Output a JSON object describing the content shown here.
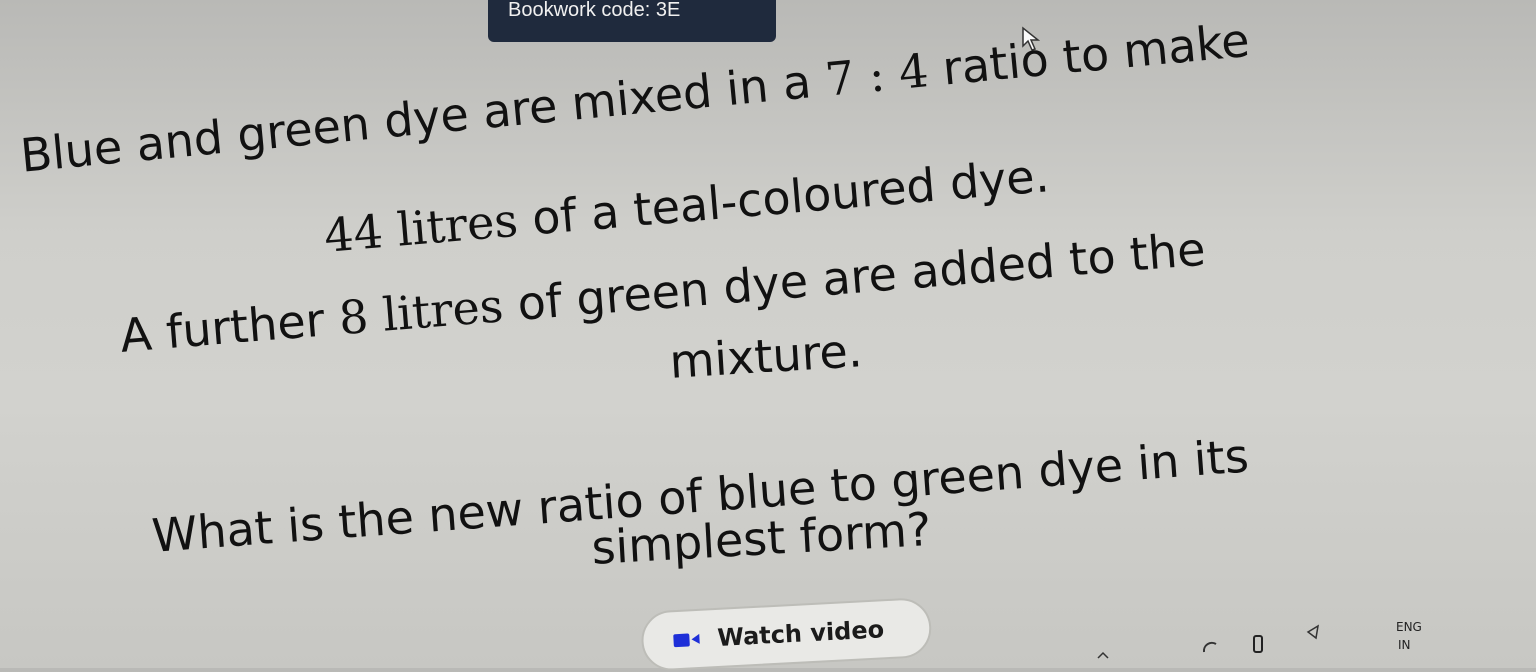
{
  "header": {
    "tab_label": "Bookwork code: 3E"
  },
  "question": {
    "line1_pre": "Blue and green dye are mixed in a ",
    "line1_ratio": "7 : 4",
    "line1_post": " ratio to make",
    "line2_num": "44 litres",
    "line2_post": " of a teal-coloured dye.",
    "line3_pre": "A further ",
    "line3_num": "8 litres",
    "line3_post": " of green dye are added to the",
    "line4": "mixture.",
    "line5": "What is the new ratio of blue to green dye in its",
    "line6": "simplest form?"
  },
  "actions": {
    "watch_video_label": "Watch video"
  },
  "tray": {
    "lang_top": "ENG",
    "lang_bottom": "IN"
  },
  "icons": {
    "video": "video-icon",
    "cursor": "cursor-pointer-icon",
    "volume": "volume-icon",
    "battery": "battery-icon",
    "chevron": "chevron-up-icon"
  },
  "colors": {
    "tab_bg": "#1f2a3d",
    "text": "#111111",
    "button_bg": "#e9e9e6"
  }
}
